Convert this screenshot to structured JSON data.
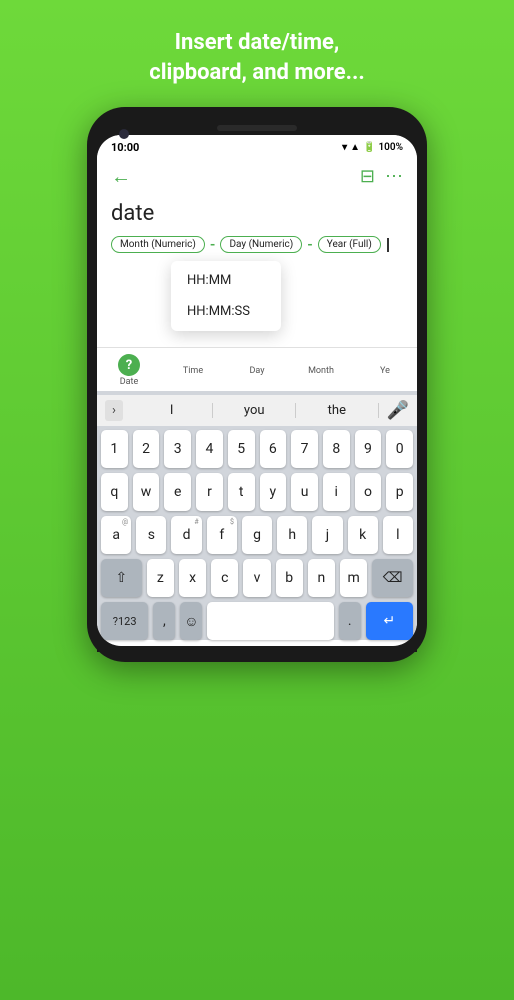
{
  "header": {
    "title_line1": "Insert date/time,",
    "title_line2": "clipboard, and more..."
  },
  "status_bar": {
    "time": "10:00",
    "battery": "100%"
  },
  "toolbar": {
    "back_label": "←",
    "filter_label": "⊟",
    "more_label": "⋯"
  },
  "editor": {
    "label": "date",
    "chip1": "Month (Numeric)",
    "chip2": "Day (Numeric)",
    "chip3": "Year (Full)"
  },
  "dropdown": {
    "item1": "HH:MM",
    "item2": "HH:MM:SS"
  },
  "tabs": [
    {
      "label": "Date",
      "icon": "?"
    },
    {
      "label": "Time"
    },
    {
      "label": "Day"
    },
    {
      "label": "Month"
    },
    {
      "label": "Ye..."
    }
  ],
  "suggestions": {
    "word1": "I",
    "word2": "you",
    "word3": "the"
  },
  "keyboard": {
    "row1": [
      "1",
      "2",
      "3",
      "4",
      "5",
      "6",
      "7",
      "8",
      "9",
      "0"
    ],
    "row2": [
      {
        "key": "q"
      },
      {
        "key": "w"
      },
      {
        "key": "e"
      },
      {
        "key": "r",
        "sup": ""
      },
      {
        "key": "t",
        "sup": ""
      },
      {
        "key": "y"
      },
      {
        "key": "u"
      },
      {
        "key": "i"
      },
      {
        "key": "o"
      },
      {
        "key": "p"
      }
    ],
    "row3": [
      {
        "key": "a",
        "sup": "@"
      },
      {
        "key": "s"
      },
      {
        "key": "d",
        "sup": "#"
      },
      {
        "key": "f",
        "sup": "$"
      },
      {
        "key": "g"
      },
      {
        "key": "h"
      },
      {
        "key": "j"
      },
      {
        "key": "k"
      },
      {
        "key": "l"
      }
    ],
    "row4_shift": "⇧",
    "row4": [
      {
        "key": "z"
      },
      {
        "key": "x"
      },
      {
        "key": "c"
      },
      {
        "key": "v"
      },
      {
        "key": "b"
      },
      {
        "key": "n"
      },
      {
        "key": "m"
      }
    ],
    "row4_del": "⌫",
    "bottom_left": "?123",
    "bottom_comma": ",",
    "bottom_emoji": "☺",
    "bottom_space": "",
    "bottom_period": ".",
    "bottom_enter": "↵"
  }
}
